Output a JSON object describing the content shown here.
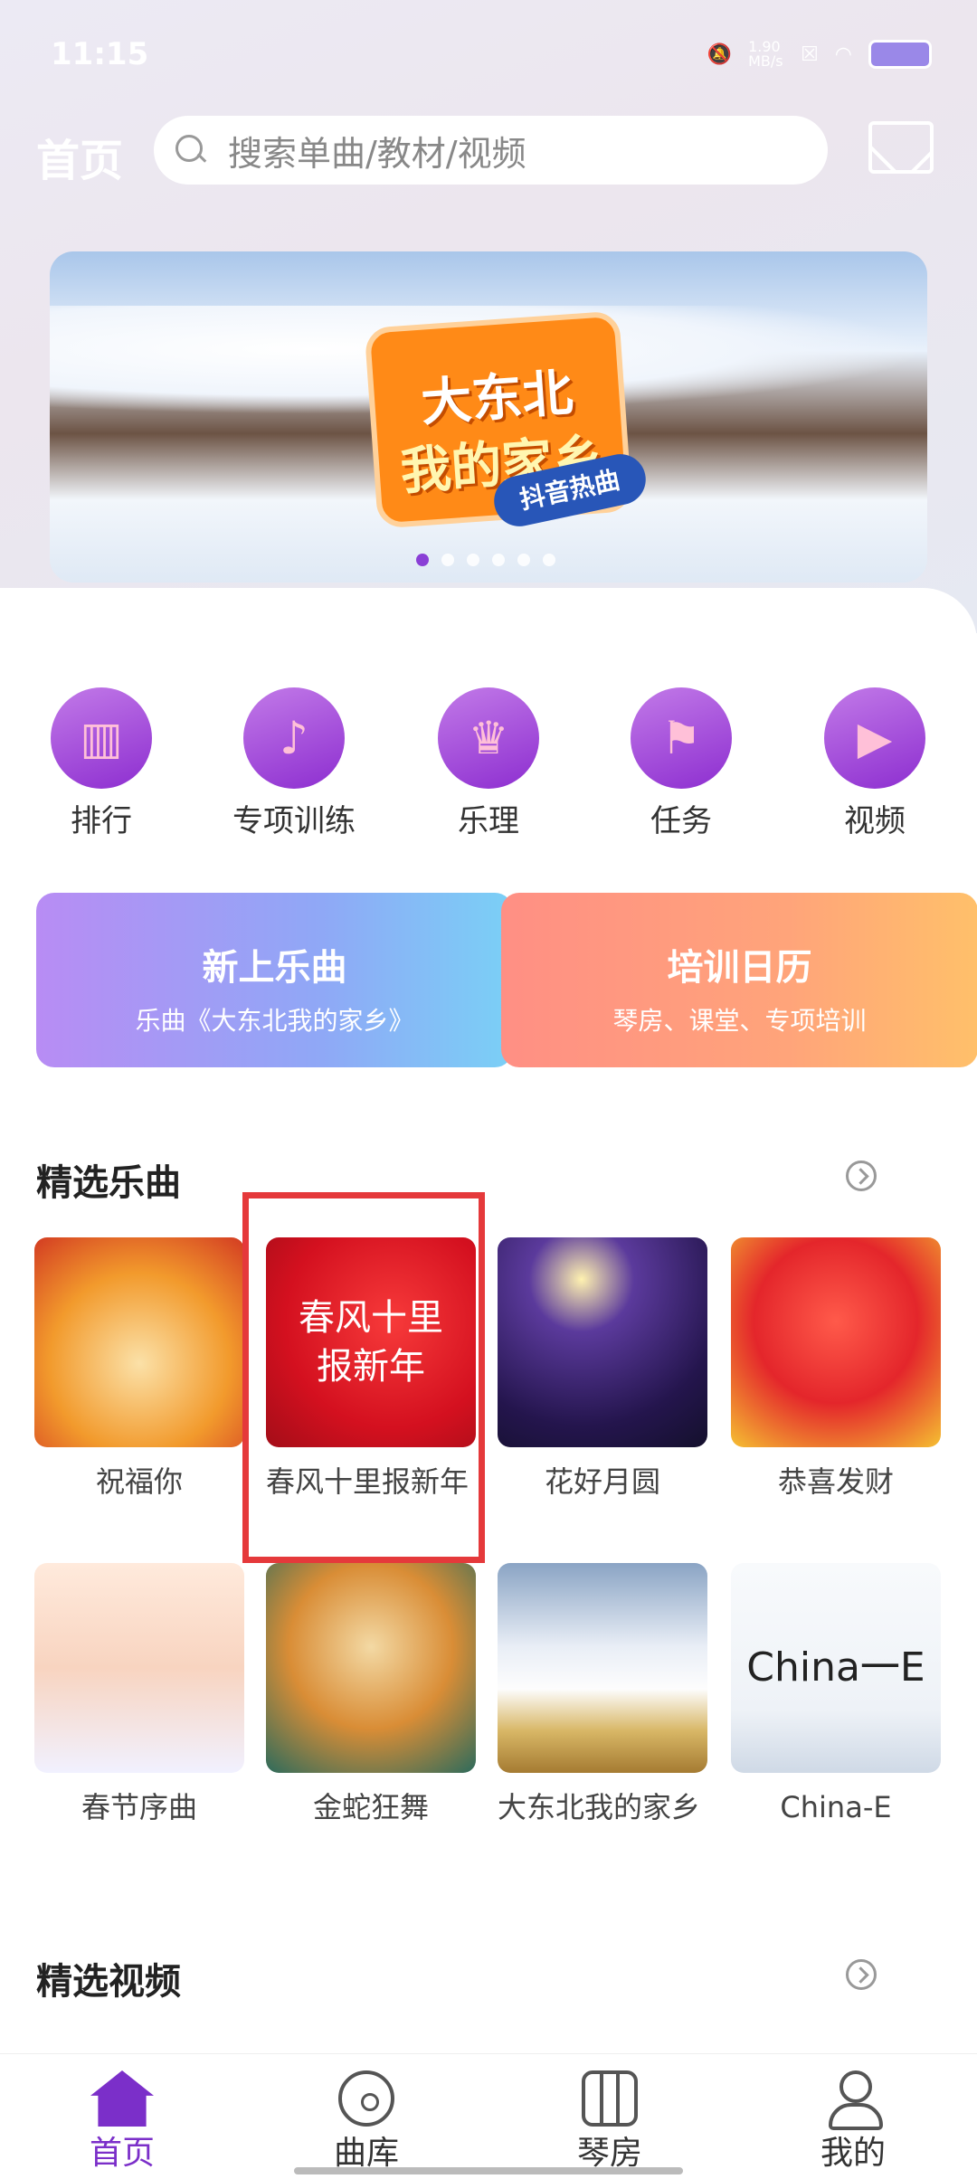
{
  "status_bar": {
    "time": "11:15",
    "speed": "1.90 MB/s"
  },
  "header": {
    "title": "首页",
    "search_placeholder": "搜索单曲/教材/视频"
  },
  "banner": {
    "headline_1": "大东北",
    "headline_2": "我的家乡",
    "tag": "抖音热曲",
    "slides": 6,
    "active_slide": 1
  },
  "quick_nav": [
    {
      "label": "排行",
      "icon": "ranking-icon"
    },
    {
      "label": "专项训练",
      "icon": "music-note-icon"
    },
    {
      "label": "乐理",
      "icon": "trophy-icon"
    },
    {
      "label": "任务",
      "icon": "flag-icon"
    },
    {
      "label": "视频",
      "icon": "video-camera-icon"
    }
  ],
  "promos": [
    {
      "title": "新上乐曲",
      "subtitle": "乐曲《大东北我的家乡》"
    },
    {
      "title": "培训日历",
      "subtitle": "琴房、课堂、专项培训"
    }
  ],
  "featured_songs": {
    "title": "精选乐曲",
    "items": [
      {
        "label": "祝福你"
      },
      {
        "label": "春风十里报新年",
        "cover_text": "春风十里报新年"
      },
      {
        "label": "花好月圆"
      },
      {
        "label": "恭喜发财"
      },
      {
        "label": "春节序曲"
      },
      {
        "label": "金蛇狂舞"
      },
      {
        "label": "大东北我的家乡"
      },
      {
        "label": "China-E",
        "cover_text": "China一E"
      }
    ]
  },
  "featured_videos": {
    "title": "精选视频"
  },
  "bottom_nav": [
    {
      "label": "首页",
      "active": true
    },
    {
      "label": "曲库"
    },
    {
      "label": "琴房"
    },
    {
      "label": "我的"
    }
  ],
  "colors": {
    "accent": "#7b2fc9",
    "highlight_box": "#e5393b"
  }
}
